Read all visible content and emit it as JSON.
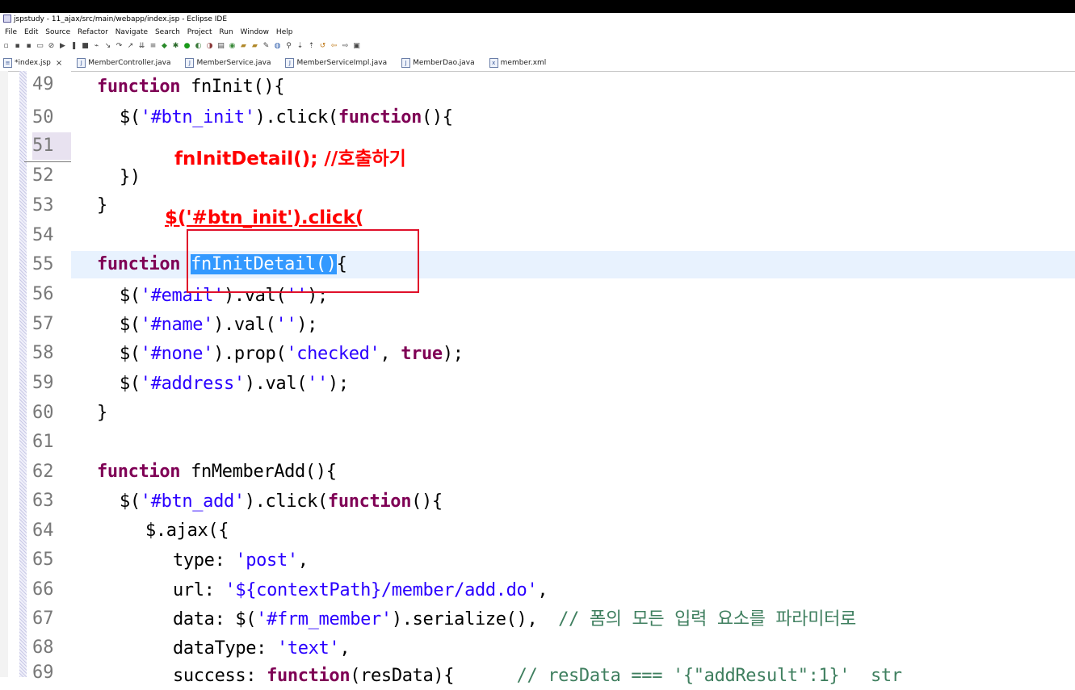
{
  "window": {
    "title": "jspstudy - 11_ajax/src/main/webapp/index.jsp - Eclipse IDE"
  },
  "menu": [
    "File",
    "Edit",
    "Source",
    "Refactor",
    "Navigate",
    "Search",
    "Project",
    "Run",
    "Window",
    "Help"
  ],
  "tabs": [
    {
      "label": "*index.jsp",
      "active": true,
      "icon": "jsp-file-icon"
    },
    {
      "label": "MemberController.java",
      "icon": "java-file-icon"
    },
    {
      "label": "MemberService.java",
      "icon": "java-file-icon"
    },
    {
      "label": "MemberServiceImpl.java",
      "icon": "java-file-icon"
    },
    {
      "label": "MemberDao.java",
      "icon": "java-file-icon"
    },
    {
      "label": "member.xml",
      "icon": "xml-file-icon"
    }
  ],
  "line_numbers": [
    "49",
    "50",
    "51",
    "52",
    "53",
    "54",
    "55",
    "56",
    "57",
    "58",
    "59",
    "60",
    "61",
    "62",
    "63",
    "64",
    "65",
    "66",
    "67",
    "68",
    "69"
  ],
  "current_line": "55",
  "code": {
    "l49": {
      "kw": "function",
      "rest": " fnInit(){"
    },
    "l50": {
      "a": "$(",
      "s": "'#btn_init'",
      "b": ").click(",
      "kw": "function",
      "c": "(){"
    },
    "l52": {
      "t": "})"
    },
    "l53": {
      "t": "}"
    },
    "l55": {
      "kw": "function",
      "a": " ",
      "sel": "fnInitDetail()",
      "b": "{"
    },
    "l56": {
      "a": "$(",
      "s": "'#email'",
      "b": ").val(",
      "s2": "''",
      "c": ");"
    },
    "l57": {
      "a": "$(",
      "s": "'#name'",
      "b": ").val(",
      "s2": "''",
      "c": ");"
    },
    "l58": {
      "a": "$(",
      "s": "'#none'",
      "b": ").prop(",
      "s2": "'checked'",
      "c": ", ",
      "kw": "true",
      "d": ");"
    },
    "l59": {
      "a": "$(",
      "s": "'#address'",
      "b": ").val(",
      "s2": "''",
      "c": ");"
    },
    "l60": {
      "t": "}"
    },
    "l62": {
      "kw": "function",
      "rest": " fnMemberAdd(){"
    },
    "l63": {
      "a": "$(",
      "s": "'#btn_add'",
      "b": ").click(",
      "kw": "function",
      "c": "(){"
    },
    "l64": {
      "t": "$.ajax({"
    },
    "l65": {
      "a": "type: ",
      "s": "'post'",
      "b": ","
    },
    "l66": {
      "a": "url: ",
      "s": "'${contextPath}/member/add.do'",
      "b": ","
    },
    "l67": {
      "a": "data: $(",
      "s": "'#frm_member'",
      "b": ").serialize(),  ",
      "cm": "// 폼의 모든 입력 요소를 파라미터로"
    },
    "l68": {
      "a": "dataType: ",
      "s": "'text'",
      "b": ","
    },
    "l69": {
      "a": "success: ",
      "kw": "function",
      "b": "(resData){      ",
      "cm": "// resData === '{\"addResult\":1}'  str"
    }
  },
  "annotations": {
    "call_note": "fnInitDetail(); //호출하기",
    "click_note": "$('#btn_init').click("
  },
  "colors": {
    "keyword": "#7f0055",
    "string": "#2a00ff",
    "comment": "#3f7f5f",
    "selection": "#3399ff",
    "annotation": "#ff0000"
  }
}
